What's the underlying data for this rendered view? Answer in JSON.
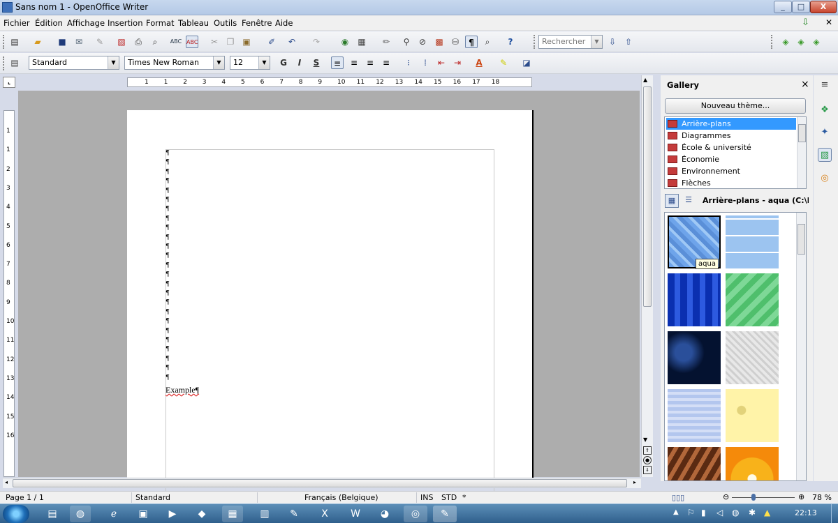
{
  "window": {
    "title": "Sans nom 1 - OpenOffice Writer",
    "min": "_",
    "max": "□",
    "close": "X"
  },
  "menu": [
    "Fichier",
    "Édition",
    "Affichage",
    "Insertion",
    "Format",
    "Tableau",
    "Outils",
    "Fenêtre",
    "Aide"
  ],
  "toolbar": {
    "search_value": "Rechercher"
  },
  "format": {
    "style": "Standard",
    "font": "Times New Roman",
    "size": "12",
    "bold": "G",
    "italic": "I",
    "underline": "S"
  },
  "ruler": {
    "h_ticks": [
      "1",
      "1",
      "2",
      "3",
      "4",
      "5",
      "6",
      "7",
      "8",
      "9",
      "10",
      "11",
      "12",
      "13",
      "14",
      "15",
      "16",
      "17",
      "18"
    ],
    "v_ticks": [
      "1",
      "1",
      "2",
      "3",
      "4",
      "5",
      "6",
      "7",
      "8",
      "9",
      "10",
      "11",
      "12",
      "13",
      "14",
      "15",
      "16"
    ]
  },
  "document": {
    "text": "Example¶",
    "pilcrow": "¶"
  },
  "gallery": {
    "title": "Gallery",
    "close": "×",
    "new_theme": "Nouveau thème...",
    "themes": [
      "Arrière-plans",
      "Diagrammes",
      "École & université",
      "Économie",
      "Environnement",
      "Flèches"
    ],
    "selected_theme": 0,
    "current_path": "Arrière-plans - aqua (C:\\Progr",
    "tooltip": "aqua"
  },
  "status": {
    "page": "Page 1 / 1",
    "style": "Standard",
    "language": "Français (Belgique)",
    "ins": "INS",
    "std": "STD",
    "modified": "*",
    "zoom": "78 %"
  },
  "taskbar": {
    "time": "22:13"
  },
  "colors": {
    "selection": "#3399ff",
    "doc_bg": "#adadad",
    "taskbar": "#2f5f8c"
  }
}
